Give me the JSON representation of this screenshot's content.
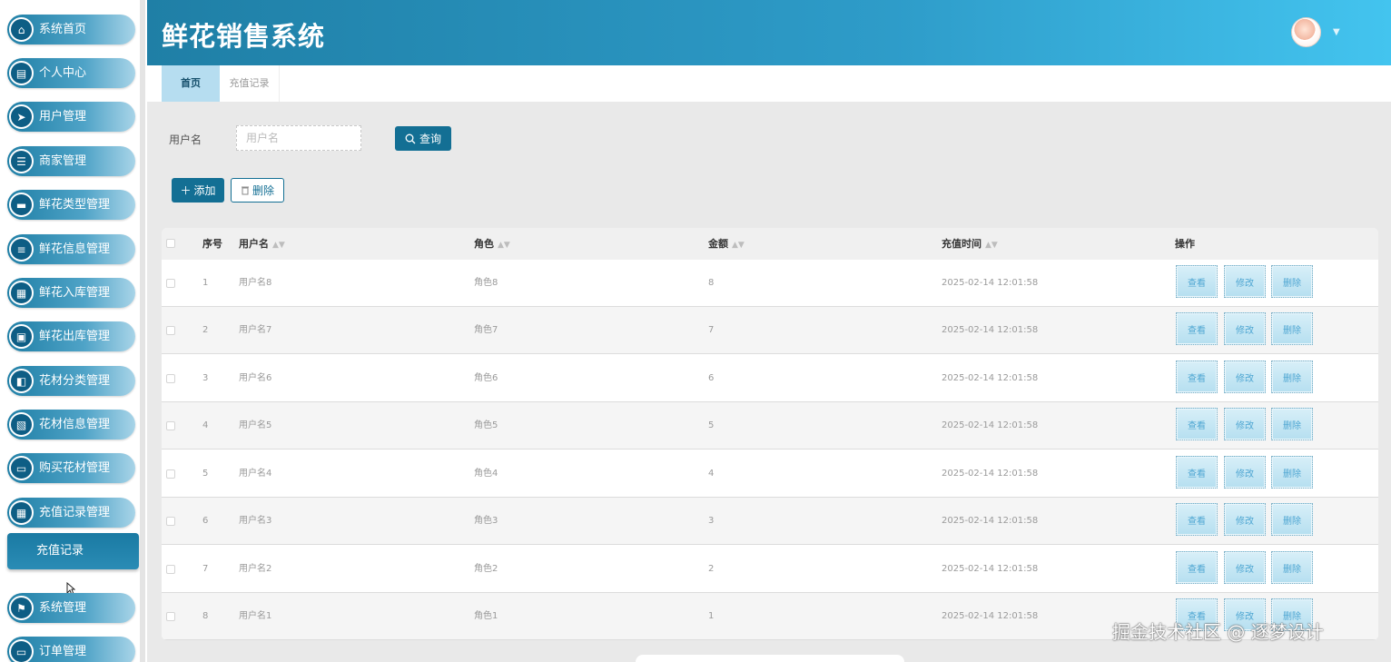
{
  "app": {
    "title": "鲜花销售系统"
  },
  "sidebar": {
    "items": [
      {
        "label": "系统首页",
        "icon": "home-icon"
      },
      {
        "label": "个人中心",
        "icon": "profile-icon"
      },
      {
        "label": "用户管理",
        "icon": "send-icon"
      },
      {
        "label": "商家管理",
        "icon": "sliders-icon"
      },
      {
        "label": "鲜花类型管理",
        "icon": "chat-icon"
      },
      {
        "label": "鲜花信息管理",
        "icon": "list-icon"
      },
      {
        "label": "鲜花入库管理",
        "icon": "grid-icon"
      },
      {
        "label": "鲜花出库管理",
        "icon": "clipboard-icon"
      },
      {
        "label": "花材分类管理",
        "icon": "thumb-icon"
      },
      {
        "label": "花材信息管理",
        "icon": "checklist-icon"
      },
      {
        "label": "购买花材管理",
        "icon": "cart-icon"
      },
      {
        "label": "充值记录管理",
        "icon": "grid-icon"
      },
      {
        "label": "系统管理",
        "icon": "flag-icon"
      },
      {
        "label": "订单管理",
        "icon": "monitor-icon"
      }
    ],
    "active_sub": "充值记录"
  },
  "tabs": [
    {
      "label": "首页",
      "active": true
    },
    {
      "label": "充值记录",
      "active": false
    }
  ],
  "search": {
    "label": "用户名",
    "placeholder": "用户名",
    "button": "查询"
  },
  "toolbar": {
    "add": "添加",
    "delete": "删除"
  },
  "table": {
    "headers": {
      "index": "序号",
      "username": "用户名",
      "role": "角色",
      "amount": "金额",
      "time": "充值时间",
      "actions": "操作"
    },
    "rows": [
      {
        "index": "1",
        "username": "用户名8",
        "role": "角色8",
        "amount": "8",
        "time": "2025-02-14 12:01:58"
      },
      {
        "index": "2",
        "username": "用户名7",
        "role": "角色7",
        "amount": "7",
        "time": "2025-02-14 12:01:58"
      },
      {
        "index": "3",
        "username": "用户名6",
        "role": "角色6",
        "amount": "6",
        "time": "2025-02-14 12:01:58"
      },
      {
        "index": "4",
        "username": "用户名5",
        "role": "角色5",
        "amount": "5",
        "time": "2025-02-14 12:01:58"
      },
      {
        "index": "5",
        "username": "用户名4",
        "role": "角色4",
        "amount": "4",
        "time": "2025-02-14 12:01:58"
      },
      {
        "index": "6",
        "username": "用户名3",
        "role": "角色3",
        "amount": "3",
        "time": "2025-02-14 12:01:58"
      },
      {
        "index": "7",
        "username": "用户名2",
        "role": "角色2",
        "amount": "2",
        "time": "2025-02-14 12:01:58"
      },
      {
        "index": "8",
        "username": "用户名1",
        "role": "角色1",
        "amount": "1",
        "time": "2025-02-14 12:01:58"
      }
    ],
    "row_actions": {
      "view": "查看",
      "edit": "修改",
      "delete": "删除"
    }
  },
  "watermark": "掘金技术社区 @ 逐梦设计"
}
